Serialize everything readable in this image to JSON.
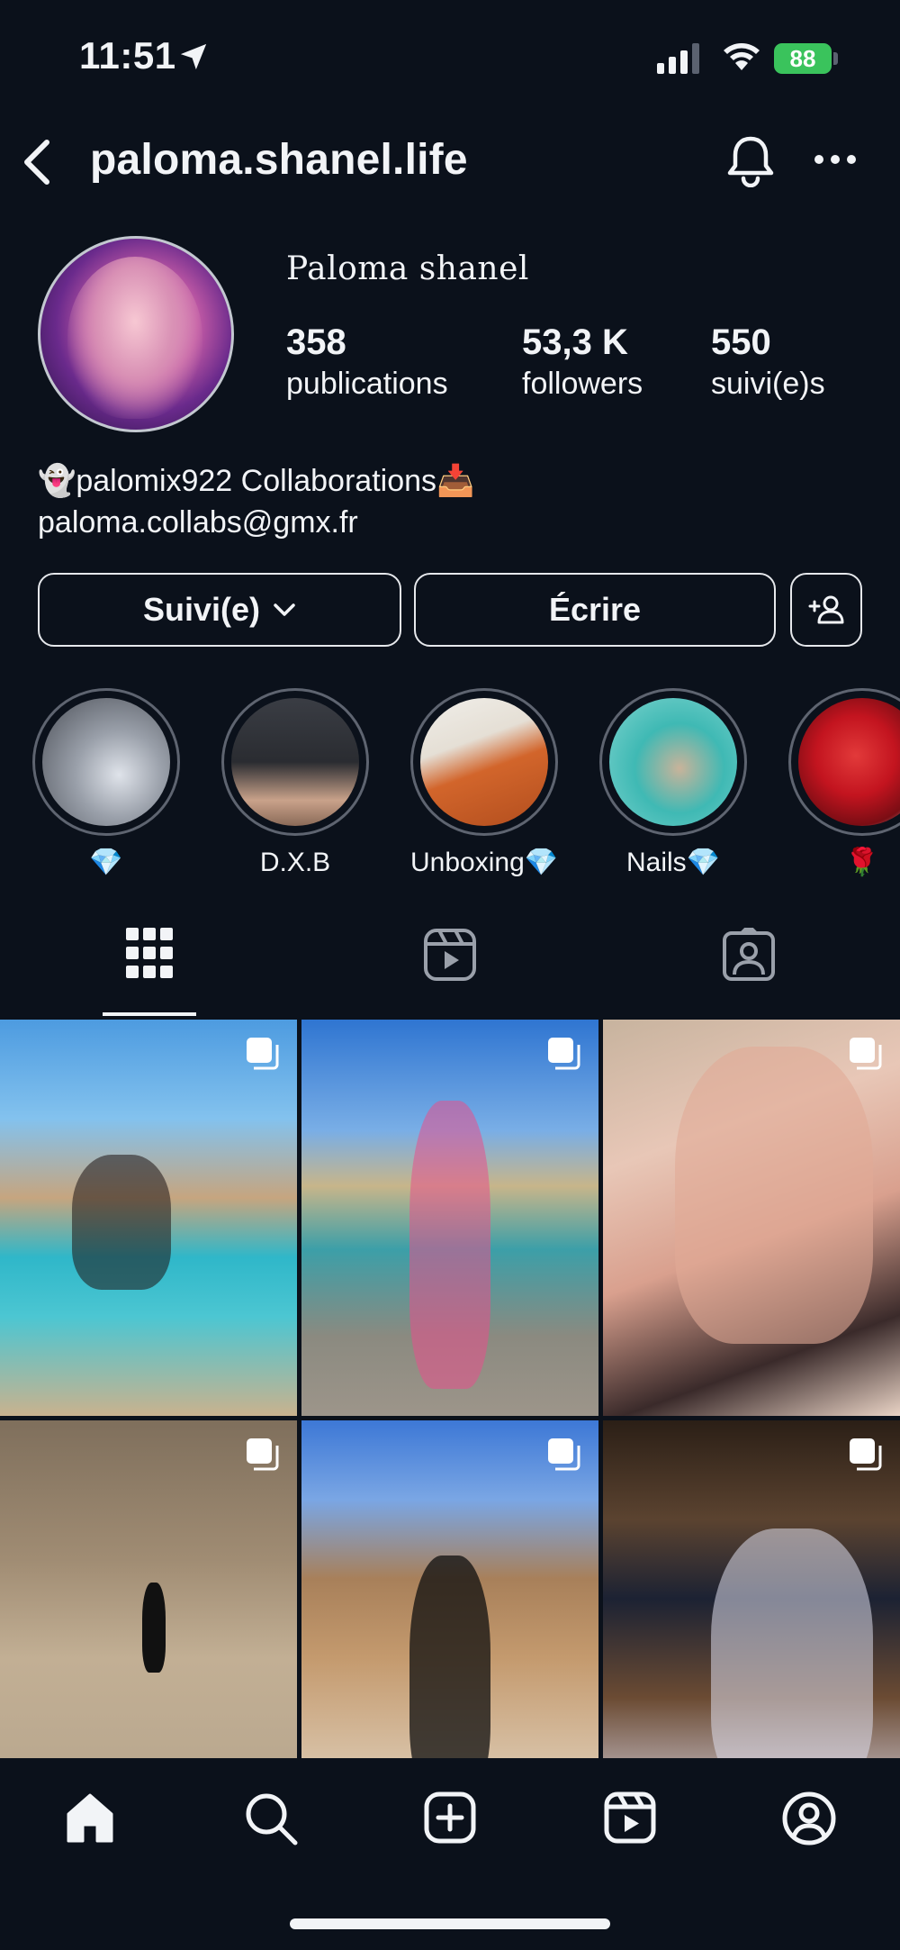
{
  "status": {
    "time": "11:51",
    "battery": "88"
  },
  "header": {
    "username": "paloma.shanel.life"
  },
  "profile": {
    "display_name": "Paloma shanel",
    "stats": [
      {
        "value": "358",
        "label": "publications"
      },
      {
        "value": "53,3 K",
        "label": "followers"
      },
      {
        "value": "550",
        "label": "suivi(e)s"
      }
    ],
    "bio": [
      "👻palomix922 Collaborations📥",
      "paloma.collabs@gmx.fr"
    ]
  },
  "actions": {
    "following": "Suivi(e)",
    "message": "Écrire"
  },
  "highlights": [
    {
      "label": "💎",
      "color1": "#6d7380",
      "color2": "#dfe3ea"
    },
    {
      "label": "D.X.B",
      "color1": "#3a3d44",
      "color2": "#c9a28a"
    },
    {
      "label": "Unboxing💎",
      "color1": "#f0eee9",
      "color2": "#d2652b"
    },
    {
      "label": "Nails💎",
      "color1": "#3fb9b4",
      "color2": "#c9b39a"
    },
    {
      "label": "🌹",
      "color1": "#c3141f",
      "color2": "#f3f0ee"
    }
  ],
  "tabs": [
    "grid-icon",
    "reels-icon",
    "tagged-icon"
  ],
  "nav": [
    "home-icon",
    "search-icon",
    "create-icon",
    "reels-icon",
    "profile-icon"
  ]
}
